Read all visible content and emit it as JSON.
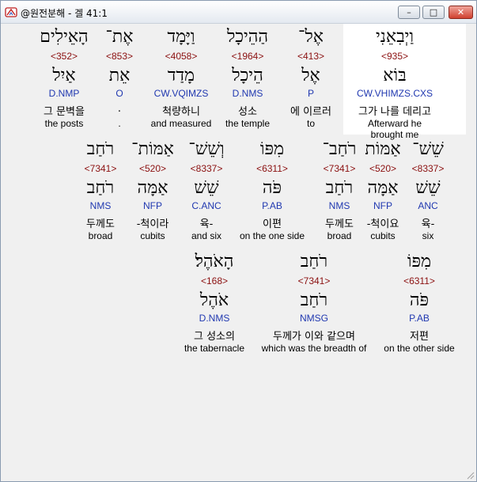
{
  "window": {
    "title": "@원전분해 - 겔 41:1",
    "min_glyph": "–",
    "max_glyph": "□",
    "close_glyph": "✕"
  },
  "rows": [
    [
      {
        "heb": "וַיְבִאֵנִי",
        "strong": "<935>",
        "lex": "בּוֹא",
        "parse": "CW.VHIMZS.CXS",
        "kor": "그가 나를 데리고",
        "eng": "Afterward he brought me",
        "highlight": true
      },
      {
        "heb": "אֶל־",
        "strong": "<413>",
        "lex": "אֶל",
        "parse": "P",
        "kor": "에 이르러",
        "eng": "to"
      },
      {
        "heb": "הַהֵיכָל",
        "strong": "<1964>",
        "lex": "הֵיכָל",
        "parse": "D.NMS",
        "kor": "성소",
        "eng": "the temple"
      },
      {
        "heb": "וַיָּמָד",
        "strong": "<4058>",
        "lex": "מָדַד",
        "parse": "CW.VQIMZS",
        "kor": "척량하니",
        "eng": "and measured"
      },
      {
        "heb": "אֶת־",
        "strong": "<853>",
        "lex": "אֵת",
        "parse": "O",
        "kor": ".",
        "eng": "."
      },
      {
        "heb": "הָאֵילִים",
        "strong": "<352>",
        "lex": "אַיִל",
        "parse": "D.NMP",
        "kor": "그 문벽을",
        "eng": "the posts"
      }
    ],
    [
      {
        "heb": "שֵׁשׁ־",
        "strong": "<8337>",
        "lex": "שֵׁשׁ",
        "parse": "ANC",
        "kor": "육-",
        "eng": "six"
      },
      {
        "heb": "אַמּוֹת",
        "strong": "<520>",
        "lex": "אַמָּה",
        "parse": "NFP",
        "kor": "-척이요",
        "eng": "cubits"
      },
      {
        "heb": "רֹחַב־",
        "strong": "<7341>",
        "lex": "רֹחַב",
        "parse": "NMS",
        "kor": "두께도",
        "eng": "broad"
      },
      {
        "heb": "מִפּוֹ",
        "strong": "<6311>",
        "lex": "פֹּה",
        "parse": "P.AB",
        "kor": "이편",
        "eng": "on the one side"
      },
      {
        "heb": "וְשֵׁשׁ־",
        "strong": "<8337>",
        "lex": "שֵׁשׁ",
        "parse": "C.ANC",
        "kor": "육-",
        "eng": "and six"
      },
      {
        "heb": "אַמּוֹת־",
        "strong": "<520>",
        "lex": "אַמָּה",
        "parse": "NFP",
        "kor": "-척이라",
        "eng": "cubits"
      },
      {
        "heb": "רֹחַב",
        "strong": "<7341>",
        "lex": "רֹחַב",
        "parse": "NMS",
        "kor": "두께도",
        "eng": "broad"
      }
    ],
    [
      {
        "heb": "מִפּוֹ",
        "strong": "<6311>",
        "lex": "פֹּה",
        "parse": "P.AB",
        "kor": "저편",
        "eng": "on the other side"
      },
      {
        "heb": "רֹחַב",
        "strong": "<7341>",
        "lex": "רֹחַב",
        "parse": "NMSG",
        "kor": "두께가 이와 같으며",
        "eng": "which was the breadth of"
      },
      {
        "heb": "הָאֹהֶל׃",
        "strong": "<168>",
        "lex": "אֹהֶל",
        "parse": "D.NMS",
        "kor": "그 성소의",
        "eng": "the tabernacle"
      }
    ]
  ]
}
